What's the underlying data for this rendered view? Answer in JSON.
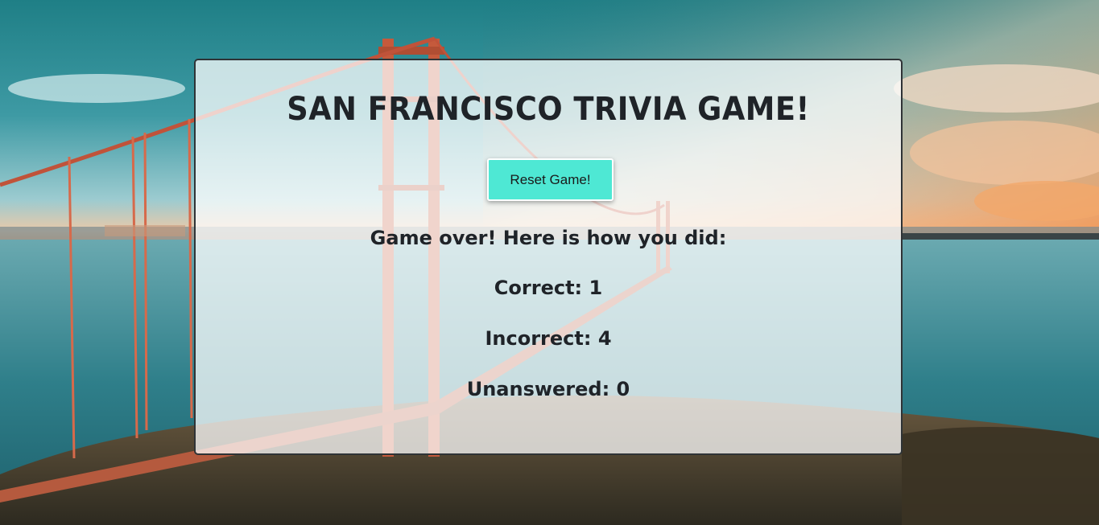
{
  "game": {
    "title": "San Francisco Trivia Game!",
    "reset_label": "Reset Game!",
    "summary": "Game over! Here is how you did:",
    "correct": "Correct: 1",
    "incorrect": "Incorrect: 4",
    "unanswered": "Unanswered: 0"
  },
  "colors": {
    "accent_button": "#4ee8d4",
    "panel_border": "#2f3336",
    "text": "#1f2328"
  },
  "background": {
    "icon": "golden-gate-bridge-photo"
  }
}
